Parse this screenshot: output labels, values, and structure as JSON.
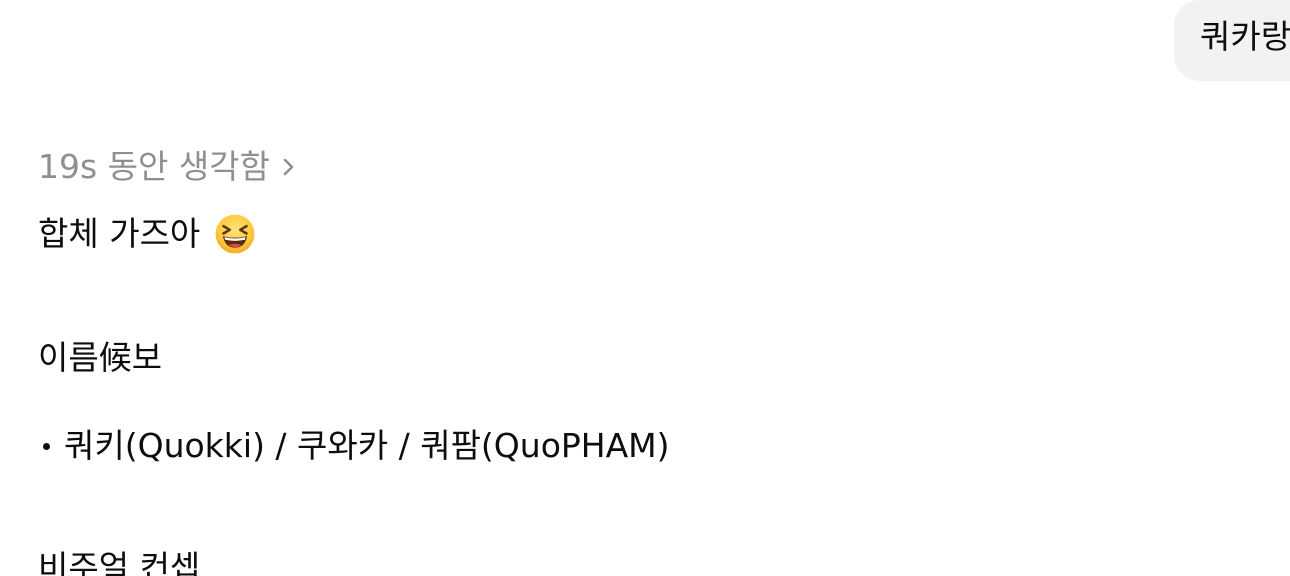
{
  "user_message": {
    "text": "쿼카랑"
  },
  "assistant": {
    "thought_label": "19s 동안 생각함",
    "reply_text": "합체 가즈아",
    "emoji": "grinning-squinting-face",
    "section_names_heading": "이름候보",
    "name_candidates": [
      "쿼키(Quokki) / 쿠와카 / 쿼팜(QuoPHAM)"
    ],
    "section_visual_heading": "비주얼 컨셉"
  }
}
